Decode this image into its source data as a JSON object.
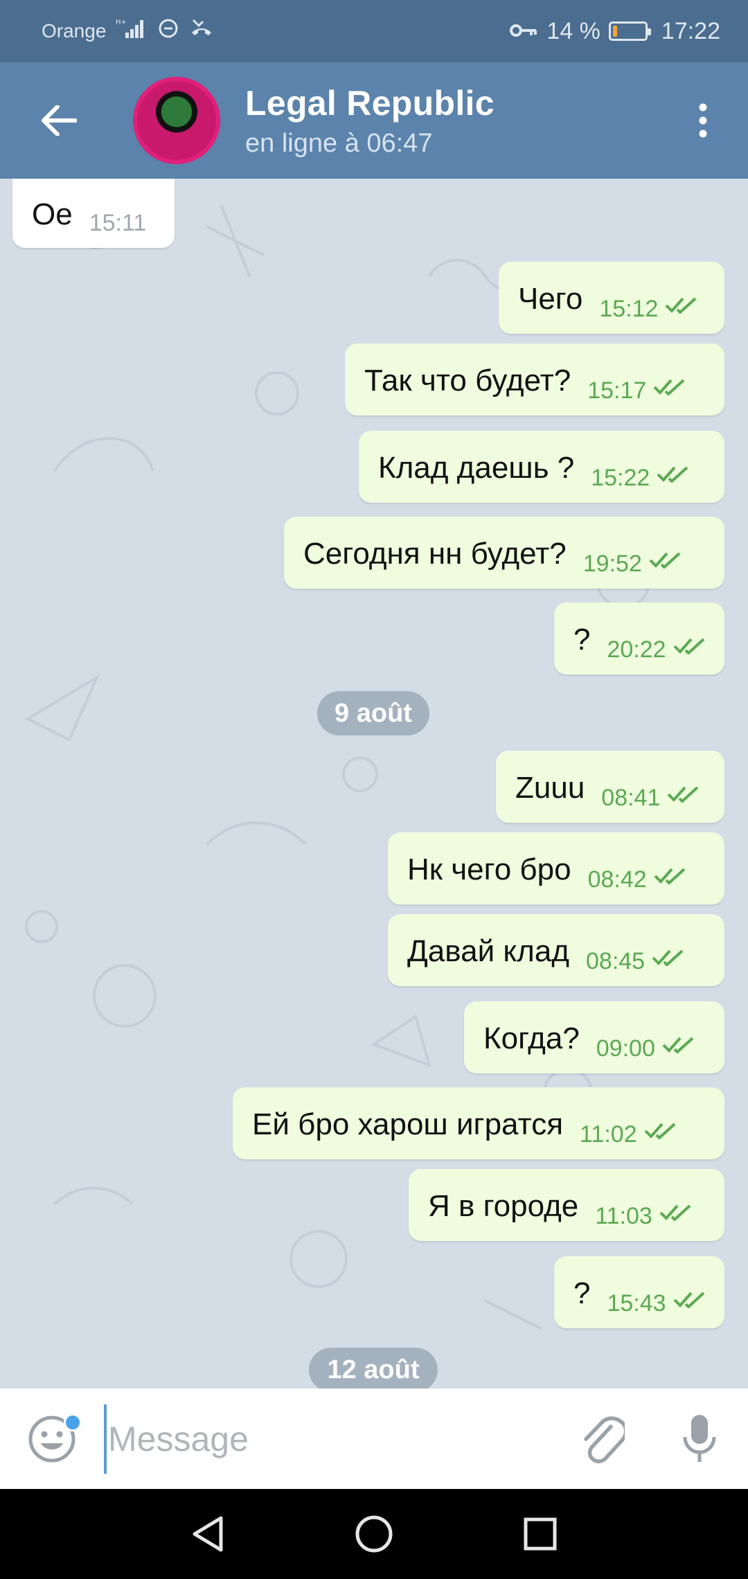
{
  "status_bar": {
    "carrier": "Orange",
    "battery_percent": "14 %",
    "battery_level": 0.14,
    "time": "17:22"
  },
  "header": {
    "contact_name": "Legal Republic",
    "status": "en ligne à 06:47"
  },
  "messages": [
    {
      "direction": "in",
      "text": "Oe",
      "time": "15:11"
    },
    {
      "direction": "out",
      "text": "Чего",
      "time": "15:12"
    },
    {
      "direction": "out",
      "text": "Так что будет?",
      "time": "15:17"
    },
    {
      "direction": "out",
      "text": "Клад даешь ?",
      "time": "15:22"
    },
    {
      "direction": "out",
      "text": "Сегодня нн будет?",
      "time": "19:52"
    },
    {
      "direction": "out",
      "text": "?",
      "time": "20:22"
    },
    {
      "direction": "out",
      "text": "Zuuu",
      "time": "08:41"
    },
    {
      "direction": "out",
      "text": "Нк чего бро",
      "time": "08:42"
    },
    {
      "direction": "out",
      "text": "Давай клад",
      "time": "08:45"
    },
    {
      "direction": "out",
      "text": "Когда?",
      "time": "09:00"
    },
    {
      "direction": "out",
      "text": "Ей бро харош игратся",
      "time": "11:02"
    },
    {
      "direction": "out",
      "text": "Я в городе",
      "time": "11:03"
    },
    {
      "direction": "out",
      "text": "?",
      "time": "15:43"
    }
  ],
  "date_separators": [
    "9 août",
    "12 août"
  ],
  "input": {
    "placeholder": "Message"
  },
  "colors": {
    "header": "#5b83ab",
    "status_bar": "#4b6d8f",
    "outgoing_bubble": "#effdde",
    "incoming_bubble": "#ffffff",
    "read_ticks": "#5ca853"
  },
  "icons": [
    "back-arrow-icon",
    "more-vertical-icon",
    "emoji-icon",
    "attach-icon",
    "microphone-icon",
    "double-check-icon",
    "nav-back-icon",
    "nav-home-icon",
    "nav-recents-icon",
    "key-icon",
    "signal-icon"
  ]
}
